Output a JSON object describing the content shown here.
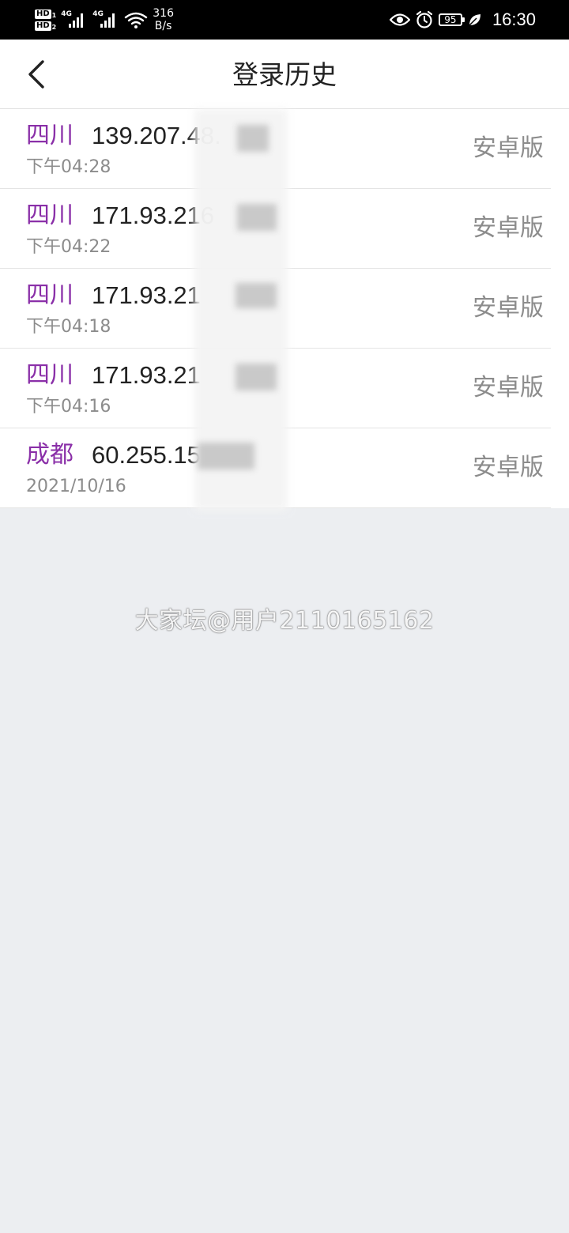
{
  "status_bar": {
    "hd1": "HD",
    "hd1_sub": "1",
    "hd2": "HD",
    "hd2_sub": "2",
    "net1": "4G",
    "net2": "4G",
    "speed_value": "316",
    "speed_unit": "B/s",
    "battery": "95",
    "time": "16:30"
  },
  "header": {
    "title": "登录历史"
  },
  "history": [
    {
      "region": "四川",
      "ip": "139.207.48.",
      "time": "下午04:28",
      "platform": "安卓版"
    },
    {
      "region": "四川",
      "ip": "171.93.216",
      "time": "下午04:22",
      "platform": "安卓版"
    },
    {
      "region": "四川",
      "ip": "171.93.21",
      "time": "下午04:18",
      "platform": "安卓版"
    },
    {
      "region": "四川",
      "ip": "171.93.21",
      "time": "下午04:16",
      "platform": "安卓版"
    },
    {
      "region": "成都",
      "ip": "60.255.15     1",
      "time": "2021/10/16",
      "platform": "安卓版"
    }
  ],
  "watermark": "大家坛@用户2110165162",
  "colors": {
    "region": "#8a2fa8",
    "background": "#eceef1"
  }
}
